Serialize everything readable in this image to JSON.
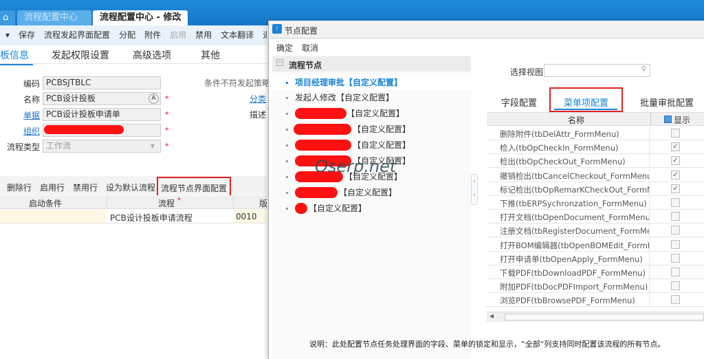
{
  "tabs": {
    "home": "⌂",
    "tab1": "流程配置中心",
    "tab2": "流程配置中心 - 修改",
    "close": "×"
  },
  "toolbar": [
    "▾",
    "保存",
    "流程发起界面配置",
    "分配",
    "附件",
    "启用",
    "禁用",
    "文本翻译",
    "退"
  ],
  "form_tabs": [
    "板信息",
    "发起权限设置",
    "高级选项",
    "其他"
  ],
  "form": {
    "code_label": "编码",
    "code": "PCBSJTBLC",
    "name_label": "名称",
    "name": "PCB设计投板",
    "doc_label": "单据",
    "doc": "PCB设计投板申请单",
    "org_label": "组织",
    "type_label": "流程类型",
    "type": "工作流",
    "required": "*",
    "strategy_label": "条件不符发起策略",
    "category_label": "分类",
    "desc_label": "描述"
  },
  "subtoolbar": [
    "删除行",
    "启用行",
    "禁用行",
    "设为默认流程",
    "流程节点界面配置"
  ],
  "grid": {
    "headers": [
      "启动条件",
      "流程",
      "版"
    ],
    "required": "*",
    "row": [
      "",
      "PCB设计投板申请流程",
      "0010"
    ]
  },
  "dialog": {
    "title": "节点配置",
    "ok": "确定",
    "cancel": "取消",
    "tree_title": "流程节点",
    "nodes": [
      "项目经理审批【自定义配置】",
      "发起人修改【自定义配置】",
      "【自定义配置】",
      "【自定义配置】",
      "【自定义配置】",
      "【自定义配置】",
      "【自定义配置】",
      "【自定义配置】",
      "【自定义配置】"
    ],
    "watermark": "Oserp.net",
    "view_label": "选择视图",
    "view_value": "",
    "tabs": [
      "字段配置",
      "菜单项配置",
      "批量审批配置"
    ],
    "grid_headers": [
      "名称",
      "显示"
    ],
    "menu_items": [
      {
        "name": "删除附件(tbDelAttr_FormMenu)",
        "show": false
      },
      {
        "name": "检入(tbOpCheckIn_FormMenu)",
        "show": true
      },
      {
        "name": "检出(tbOpCheckOut_FormMenu)",
        "show": true
      },
      {
        "name": "撤销检出(tbCancelCheckout_FormMenu)",
        "show": true
      },
      {
        "name": "标记检出(tbOpRemarKCheckOut_FormMenu)",
        "show": true
      },
      {
        "name": "下推(tbERPSychronzation_FormMenu)",
        "show": false
      },
      {
        "name": "打开文档(tbOpenDocument_FormMenu)",
        "show": false
      },
      {
        "name": "注册文档(tbRegisterDocument_FormMenu)",
        "show": false
      },
      {
        "name": "打开BOM编辑器(tbOpenBOMEdit_FormMenu)",
        "show": false
      },
      {
        "name": "打开申请单(tbOpenApply_FormMenu)",
        "show": false
      },
      {
        "name": "下载PDF(tbDownloadPDF_FormMenu)",
        "show": false
      },
      {
        "name": "附加PDF(tbDocPDFImport_FormMenu)",
        "show": false
      },
      {
        "name": "浏览PDF(tbBrowsePDF_FormMenu)",
        "show": false
      }
    ],
    "footer": "说明：此处配置节点任务处理界面的字段、菜单的锁定和显示，“全部“列支持同时配置该流程的所有节点。"
  },
  "colors": {
    "accent": "#1a84d4",
    "highlight": "#e02020"
  }
}
